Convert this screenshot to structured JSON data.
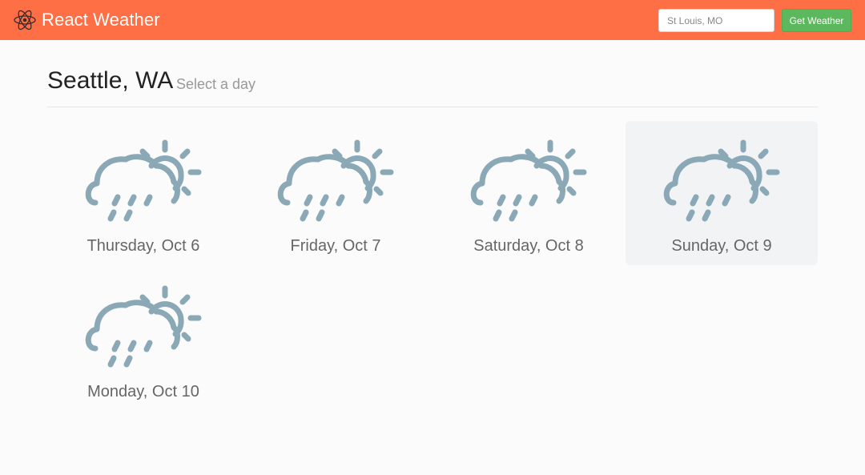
{
  "app": {
    "title": "React Weather",
    "logo_icon": "react-atom-icon",
    "brand_color": "#ff6f45"
  },
  "search": {
    "placeholder": "St Louis, MO",
    "value": "",
    "button_label": "Get Weather",
    "button_color": "#5cb85c"
  },
  "header": {
    "city": "Seattle, WA",
    "subtitle": "Select a day"
  },
  "forecast": [
    {
      "label": "Thursday, Oct 6",
      "icon": "rain-cloud-sun-icon",
      "selected": false
    },
    {
      "label": "Friday, Oct 7",
      "icon": "rain-cloud-sun-icon",
      "selected": false
    },
    {
      "label": "Saturday, Oct 8",
      "icon": "rain-cloud-sun-icon",
      "selected": false
    },
    {
      "label": "Sunday, Oct 9",
      "icon": "rain-cloud-sun-icon",
      "selected": true
    },
    {
      "label": "Monday, Oct 10",
      "icon": "rain-cloud-sun-icon",
      "selected": false
    }
  ],
  "colors": {
    "icon": "#8aa8b6",
    "selected_card": "#f1f3f5"
  }
}
